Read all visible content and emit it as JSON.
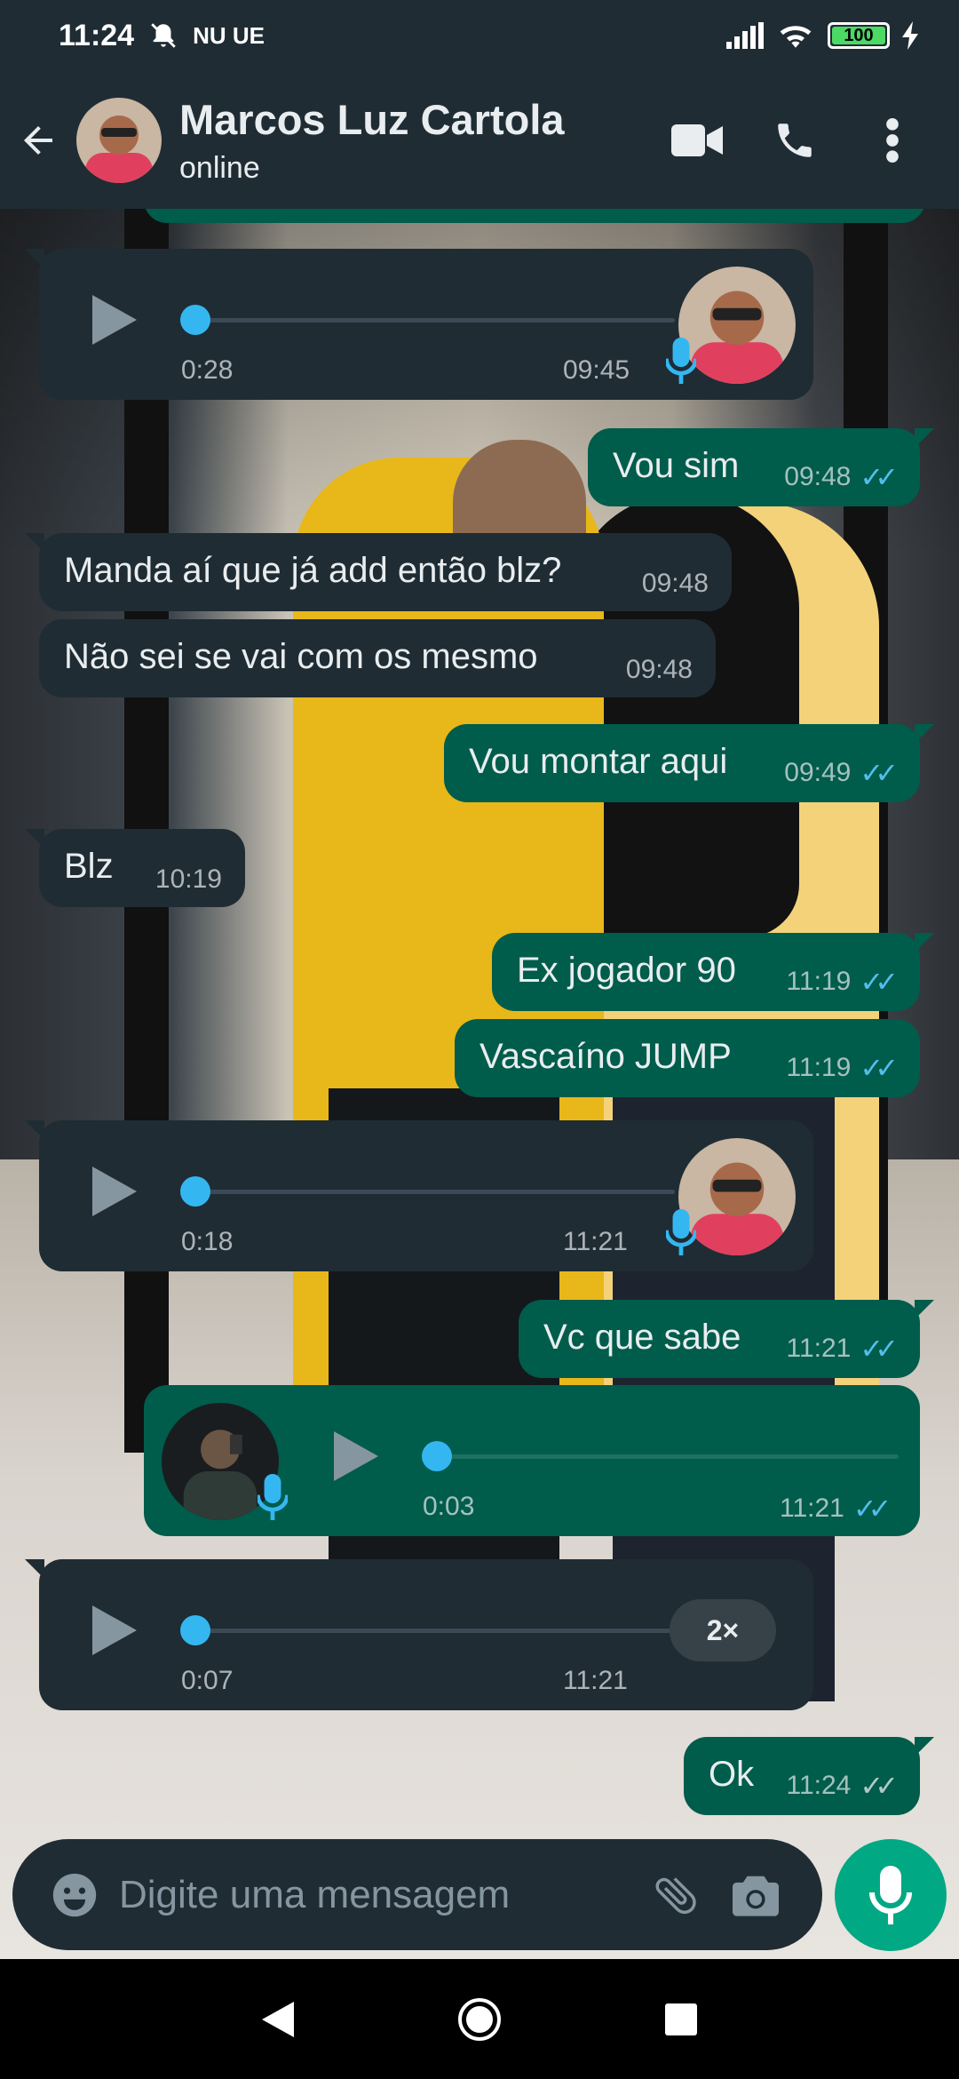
{
  "status_bar": {
    "time": "11:24",
    "carrier_icons": "NU UE",
    "battery": "100"
  },
  "header": {
    "contact_name": "Marcos Luz Cartola",
    "status": "online"
  },
  "messages": {
    "vm1": {
      "duration": "0:28",
      "time": "09:45"
    },
    "m1": {
      "text": "Vou sim",
      "time": "09:48"
    },
    "m2": {
      "text": "Manda aí que já add então blz?",
      "time": "09:48"
    },
    "m3": {
      "text": "Não sei se vai com os mesmo",
      "time": "09:48"
    },
    "m4": {
      "text": "Vou montar aqui",
      "time": "09:49"
    },
    "m5": {
      "text": "Blz",
      "time": "10:19"
    },
    "m6": {
      "text": "Ex jogador 90",
      "time": "11:19"
    },
    "m7": {
      "text": "Vascaíno JUMP",
      "time": "11:19"
    },
    "vm2": {
      "duration": "0:18",
      "time": "11:21"
    },
    "m8": {
      "text": "Vc que sabe",
      "time": "11:21"
    },
    "vm3": {
      "duration": "0:03",
      "time": "11:21"
    },
    "vm4": {
      "duration": "0:07",
      "time": "11:21",
      "speed": "2×"
    },
    "m9": {
      "text": "Ok",
      "time": "11:24"
    }
  },
  "input": {
    "placeholder": "Digite uma mensagem"
  },
  "colors": {
    "header": "#1f2c34",
    "incoming": "#1f2c34",
    "outgoing": "#005c4b",
    "accent": "#00a884",
    "read_ticks": "#53bdeb"
  },
  "icons": [
    "back-arrow-icon",
    "video-call-icon",
    "phone-icon",
    "more-vert-icon",
    "emoji-icon",
    "attach-icon",
    "camera-icon",
    "mic-icon",
    "play-icon"
  ]
}
